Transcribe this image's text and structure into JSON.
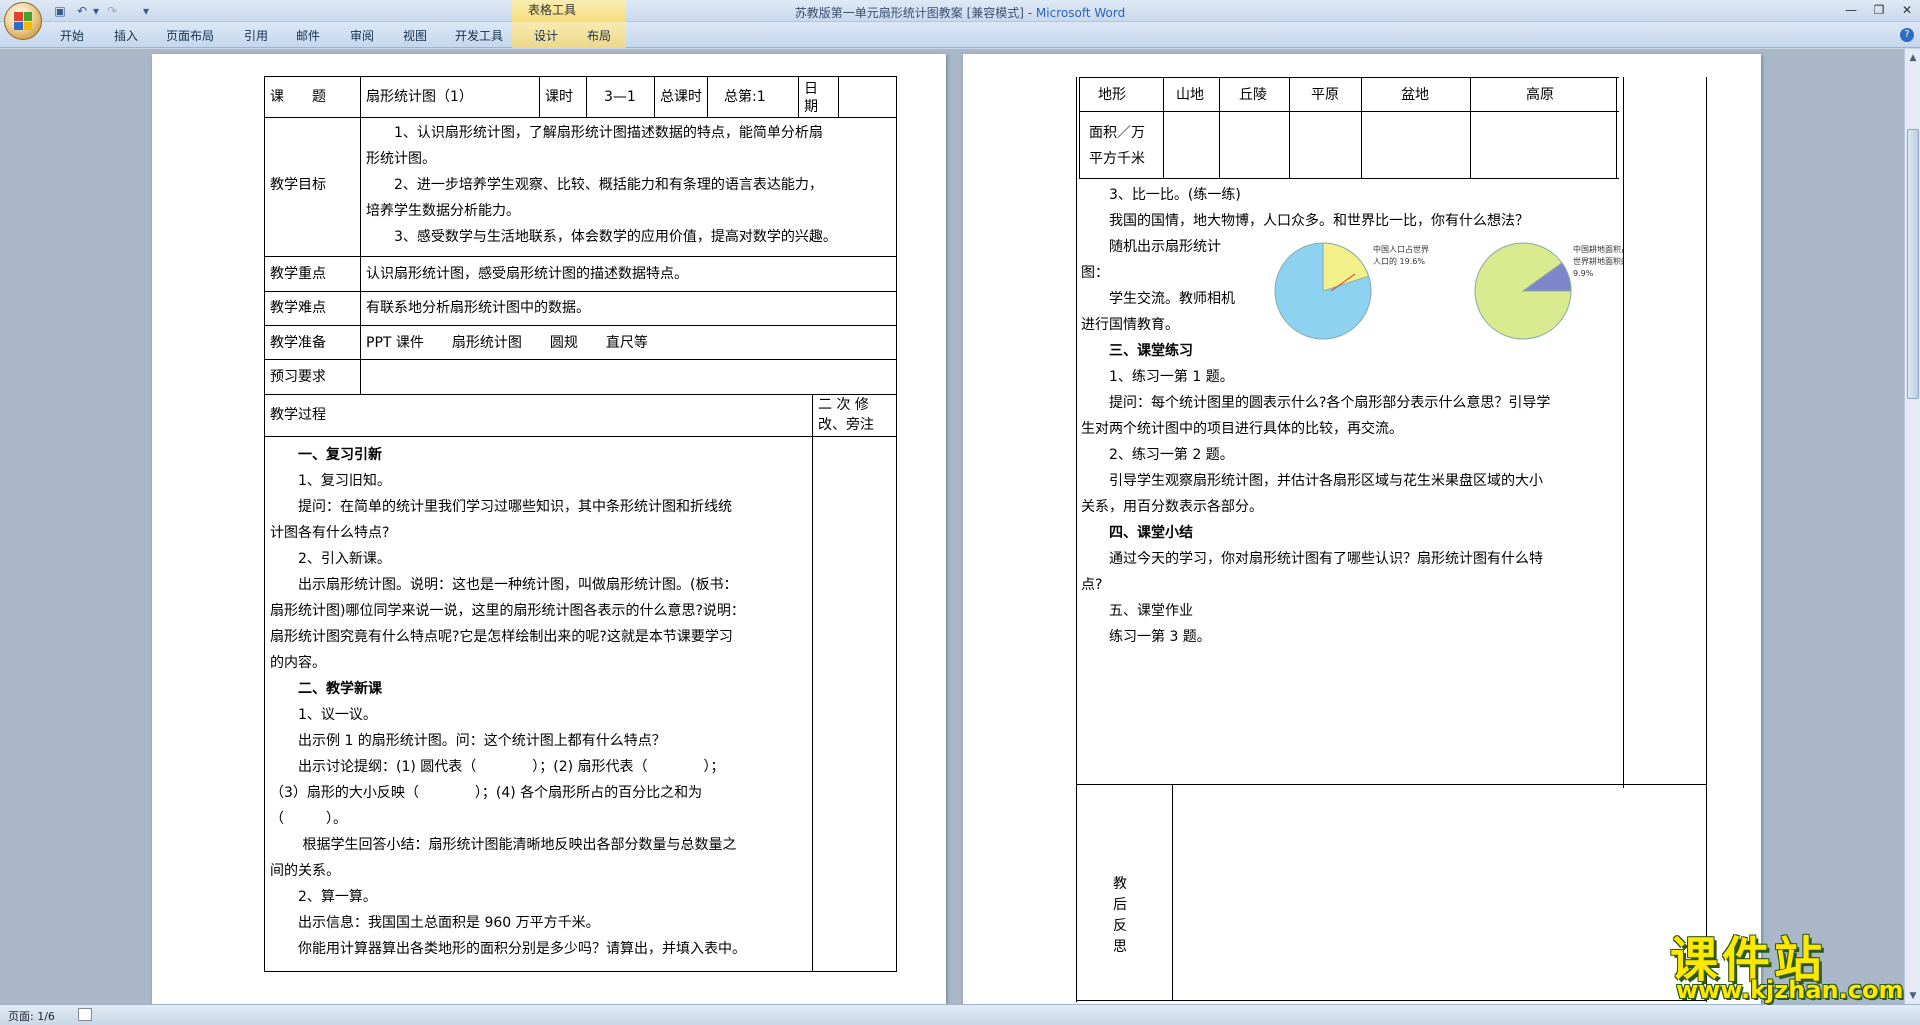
{
  "window": {
    "title": "苏教版第一单元扇形统计图教案 [兼容模式] - ",
    "app_name": "Microsoft Word",
    "context_tab_group": "表格工具"
  },
  "ribbon": {
    "tabs": [
      "开始",
      "插入",
      "页面布局",
      "引用",
      "邮件",
      "审阅",
      "视图",
      "开发工具",
      "设计",
      "布局"
    ]
  },
  "status": {
    "page": "页面: 1/6"
  },
  "page1": {
    "header": {
      "topic_label": "课　　题",
      "topic_value": "扇形统计图（1）",
      "hours_label": "课时",
      "hours_value": "3—1",
      "total_label": "总课时",
      "total_no": "总第:1",
      "date_label": "日期"
    },
    "goals_label": "教学目标",
    "goals": [
      "　　1、认识扇形统计图，了解扇形统计图描述数据的特点，能简单分析扇",
      "形统计图。",
      "　　2、进一步培养学生观察、比较、概括能力和有条理的语言表达能力，",
      "培养学生数据分析能力。",
      "　　3、感受数学与生活地联系，体会数学的应用价值，提高对数学的兴趣。"
    ],
    "key_label": "教学重点",
    "key_value": "认识扇形统计图，感受扇形统计图的描述数据特点。",
    "difficulty_label": "教学难点",
    "difficulty_value": "有联系地分析扇形统计图中的数据。",
    "prep_label": "教学准备",
    "prep_value": "PPT 课件　　扇形统计图　　圆规　　直尺等",
    "preview_label": "预习要求",
    "process_label": "教学过程",
    "revise_label_1": "二 次 修",
    "revise_label_2": "改、旁注",
    "process": [
      "　　一、复习引新",
      "　　1、复习旧知。",
      "　　提问：在简单的统计里我们学习过哪些知识，其中条形统计图和折线统",
      "计图各有什么特点?",
      "　　2、引入新课。",
      "　　出示扇形统计图。说明：这也是一种统计图，叫做扇形统计图。(板书：",
      "扇形统计图)哪位同学来说一说，这里的扇形统计图各表示的什么意思?说明：",
      "扇形统计图究竟有什么特点呢?它是怎样绘制出来的呢?这就是本节课要学习",
      "的内容。",
      "　　二、教学新课",
      "　　1、议一议。",
      "　　出示例 1 的扇形统计图。问：这个统计图上都有什么特点？",
      "　　出示讨论提纲：(1) 圆代表（　　　　）；(2) 扇形代表（　　　　）；",
      "（3）扇形的大小反映（　　　　）；(4) 各个扇形所占的百分比之和为",
      "（　　　）。",
      "　　 根据学生回答小结：扇形统计图能清晰地反映出各部分数量与总数量之",
      "间的关系。",
      "　　2、算一算。",
      "　　出示信息：我国国土总面积是 960 万平方千米。",
      "　　你能用计算器算出各类地形的面积分别是多少吗？请算出，并填入表中。"
    ]
  },
  "page2": {
    "terrain_table": {
      "headers": [
        "地形",
        "山地",
        "丘陵",
        "平原",
        "盆地",
        "高原"
      ],
      "row_label_1": "面积／万",
      "row_label_2": "平方千米"
    },
    "pie_left_label": [
      "中国人口占世界",
      "人口的 19.6%"
    ],
    "pie_right_label": [
      "中国耕地面积占",
      "世界耕地面积的",
      "9.9%"
    ],
    "text": [
      "　　3、比一比。(练一练)",
      "　　我国的国情，地大物博，人口众多。和世界比一比，你有什么想法？",
      "　　随机出示扇形统计",
      "图：",
      "　　学生交流。教师相机",
      "进行国情教育。",
      "　　三、课堂练习",
      "　　1、练习一第 1 题。",
      "　　提问：每个统计图里的圆表示什么?各个扇形部分表示什么意思？引导学",
      "生对两个统计图中的项目进行具体的比较，再交流。",
      "　　2、练习一第 2 题。",
      "　　引导学生观察扇形统计图，并估计各扇形区域与花生米果盘区域的大小",
      "关系，用百分数表示各部分。",
      "　　四、课堂小结",
      "　　通过今天的学习，你对扇形统计图有了哪些认识？扇形统计图有什么特",
      "点?",
      "　　五、课堂作业",
      "　　练习一第 3 题。"
    ],
    "reflection_label": [
      "教",
      "后",
      "反",
      "思"
    ]
  },
  "watermark": {
    "title": "课件站",
    "url": "www.kjzhan.com"
  },
  "colors": {
    "pie_left_main": "#8ed2f2",
    "pie_left_slice": "#f3f08a",
    "pie_right_main": "#d9eb8e",
    "pie_right_slice": "#7c86c8"
  }
}
